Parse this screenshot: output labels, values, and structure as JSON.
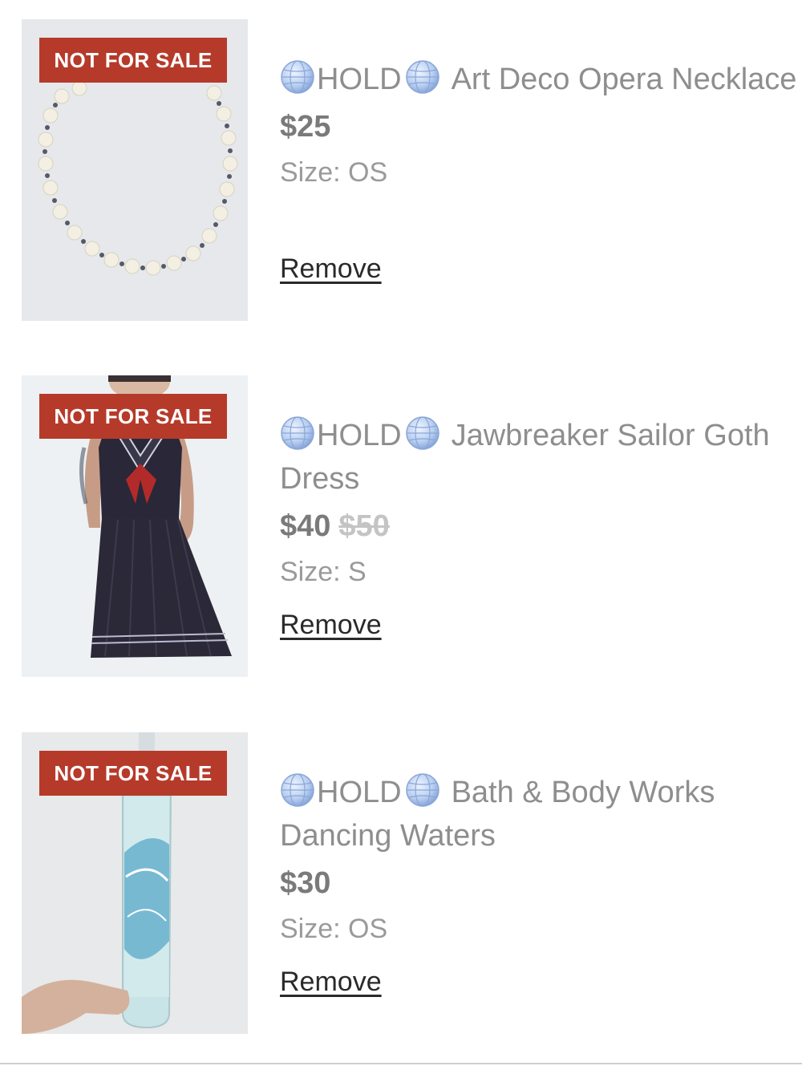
{
  "items": [
    {
      "badge": "NOT FOR SALE",
      "hold_label": "HOLD",
      "title_line1": "Art Deco Opera Necklace",
      "title_line2": "",
      "price": "$25",
      "original_price": "",
      "size": "Size: OS",
      "remove_label": "Remove",
      "image_icon": "necklace-photo"
    },
    {
      "badge": "NOT FOR SALE",
      "hold_label": "HOLD",
      "title_line1": "Jawbreaker Sailor Goth",
      "title_line2": "Dress",
      "price": "$40",
      "original_price": "$50",
      "size": "Size: S",
      "remove_label": "Remove",
      "image_icon": "dress-photo"
    },
    {
      "badge": "NOT FOR SALE",
      "hold_label": "HOLD",
      "title_line1": "Bath & Body Works",
      "title_line2": "Dancing Waters",
      "price": "$30",
      "original_price": "",
      "size": "Size: OS",
      "remove_label": "Remove",
      "image_icon": "bottle-photo"
    }
  ],
  "colors": {
    "badge_bg": "#b63a2a",
    "title_text": "#8e8e8e",
    "price_text": "#7a7a7a",
    "link_text": "#2a2a2a"
  }
}
